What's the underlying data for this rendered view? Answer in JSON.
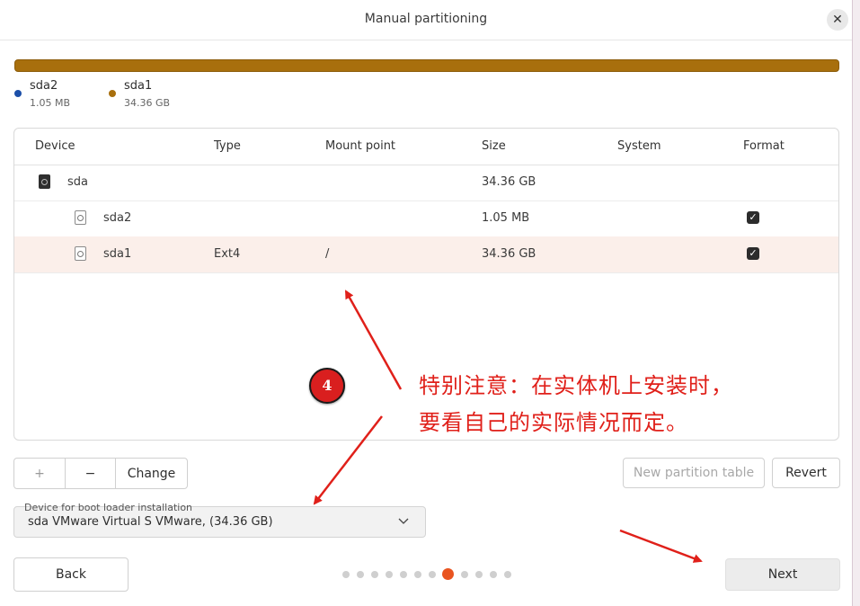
{
  "window": {
    "title": "Manual partitioning"
  },
  "colors": {
    "sda1": "#a86f0d",
    "sda2": "#1c4fa8",
    "accent": "#e95420",
    "annotation": "#e0201a"
  },
  "usage_legend": [
    {
      "name": "sda2",
      "size": "1.05 MB"
    },
    {
      "name": "sda1",
      "size": "34.36 GB"
    }
  ],
  "table": {
    "headers": [
      "Device",
      "Type",
      "Mount point",
      "Size",
      "System",
      "Format"
    ],
    "rows": [
      {
        "device": "sda",
        "type": "",
        "mount": "",
        "size": "34.36 GB",
        "system": "",
        "format": null,
        "icon": "drive-harddisk-icon"
      },
      {
        "device": "sda2",
        "type": "",
        "mount": "",
        "size": "1.05 MB",
        "system": "",
        "format": true,
        "icon": "partition-icon"
      },
      {
        "device": "sda1",
        "type": "Ext4",
        "mount": "/",
        "size": "34.36 GB",
        "system": "",
        "format": true,
        "icon": "partition-icon"
      }
    ]
  },
  "toolbar": {
    "add": "+",
    "remove": "−",
    "change": "Change",
    "new_table": "New partition table",
    "revert": "Revert"
  },
  "boot_loader": {
    "label": "Device for boot loader installation",
    "value": "sda VMware Virtual S VMware, (34.36 GB)"
  },
  "nav": {
    "back": "Back",
    "next": "Next"
  },
  "pager": {
    "total": 12,
    "current": 8
  },
  "annotation": {
    "badge": "4",
    "line1": "特别注意：在实体机上安装时，",
    "line2": "要看自己的实际情况而定。"
  }
}
